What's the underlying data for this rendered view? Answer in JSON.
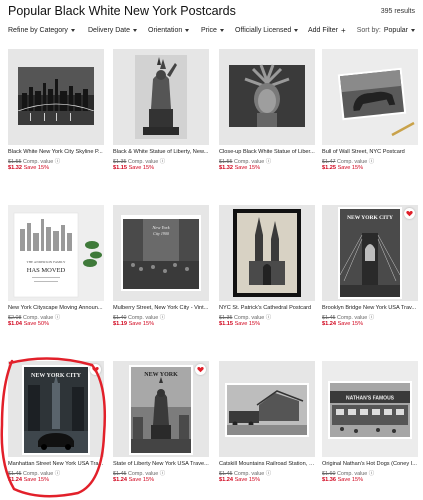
{
  "header": {
    "title": "Popular Black White New York Postcards",
    "results": "395 results"
  },
  "filters": {
    "category": "Refine by Category",
    "delivery": "Delivery Date",
    "orientation": "Orientation",
    "price": "Price",
    "licensed": "Officially Licensed",
    "add": "Add Filter",
    "sort_label": "Sort by:",
    "sort_value": "Popular"
  },
  "colors": {
    "sale": "#d0021b",
    "heart": "#e0202a",
    "annotation": "#e2202a"
  },
  "products": [
    {
      "name": "Black White New York City Skyline P...",
      "orig": "$1.55",
      "comp": "Comp. value",
      "sale": "$1.32",
      "save": "Save 15%"
    },
    {
      "name": "Black & White Statue of Liberty, New...",
      "orig": "$1.35",
      "comp": "Comp. value",
      "sale": "$1.15",
      "save": "Save 15%"
    },
    {
      "name": "Close-up Black White Statue of Liber...",
      "orig": "$1.55",
      "comp": "Comp. value",
      "sale": "$1.32",
      "save": "Save 15%"
    },
    {
      "name": "Bull of Wall Street, NYC Postcard",
      "orig": "$1.47",
      "comp": "Comp. value",
      "sale": "$1.25",
      "save": "Save 15%"
    },
    {
      "name": "New York Cityscape Moving Announ...",
      "orig": "$2.08",
      "comp": "Comp. value",
      "sale": "$1.04",
      "save": "Save 50%"
    },
    {
      "name": "Mulberry Street, New York City - Vint...",
      "orig": "$1.40",
      "comp": "Comp. value",
      "sale": "$1.19",
      "save": "Save 15%"
    },
    {
      "name": "NYC St. Patrick's Cathedral Postcard",
      "orig": "$1.35",
      "comp": "Comp. value",
      "sale": "$1.15",
      "save": "Save 15%"
    },
    {
      "name": "Brooklyn Bridge New York USA Trav...",
      "orig": "$1.45",
      "comp": "Comp. value",
      "sale": "$1.24",
      "save": "Save 15%"
    },
    {
      "name": "Manhattan Street New York USA Tra...",
      "orig": "$1.45",
      "comp": "Comp. value",
      "sale": "$1.24",
      "save": "Save 15%"
    },
    {
      "name": "State of Liberty New York USA Trave...",
      "orig": "$1.45",
      "comp": "Comp. value",
      "sale": "$1.24",
      "save": "Save 15%"
    },
    {
      "name": "Catskill Mountains Railroad Station, 1...",
      "orig": "$1.45",
      "comp": "Comp. value",
      "sale": "$1.24",
      "save": "Save 15%"
    },
    {
      "name": "Original Nathan's Hot Dogs (Coney I...",
      "orig": "$1.60",
      "comp": "Comp. value",
      "sale": "$1.36",
      "save": "Save 15%"
    }
  ],
  "card_art": [
    {
      "icon": "skyline-photo"
    },
    {
      "icon": "statue-of-liberty-photo"
    },
    {
      "icon": "statue-closeup-photo"
    },
    {
      "icon": "wall-street-bull-photo"
    },
    {
      "heading1": "THE ANDERSON FAMILY",
      "heading2": "HAS MOVED",
      "icon": "moving-announcement-card"
    },
    {
      "caption1": "New York",
      "caption2": "City 1900",
      "icon": "mulberry-street-photo"
    },
    {
      "icon": "cathedral-photo"
    },
    {
      "caption": "NEW YORK CITY",
      "icon": "brooklyn-bridge-poster"
    },
    {
      "caption": "NEW YORK CITY",
      "icon": "manhattan-street-poster"
    },
    {
      "caption": "NEW YORK",
      "icon": "liberty-poster"
    },
    {
      "icon": "railroad-station-photo"
    },
    {
      "sign": "NATHAN'S FAMOUS",
      "icon": "hot-dog-stand-photo"
    }
  ]
}
